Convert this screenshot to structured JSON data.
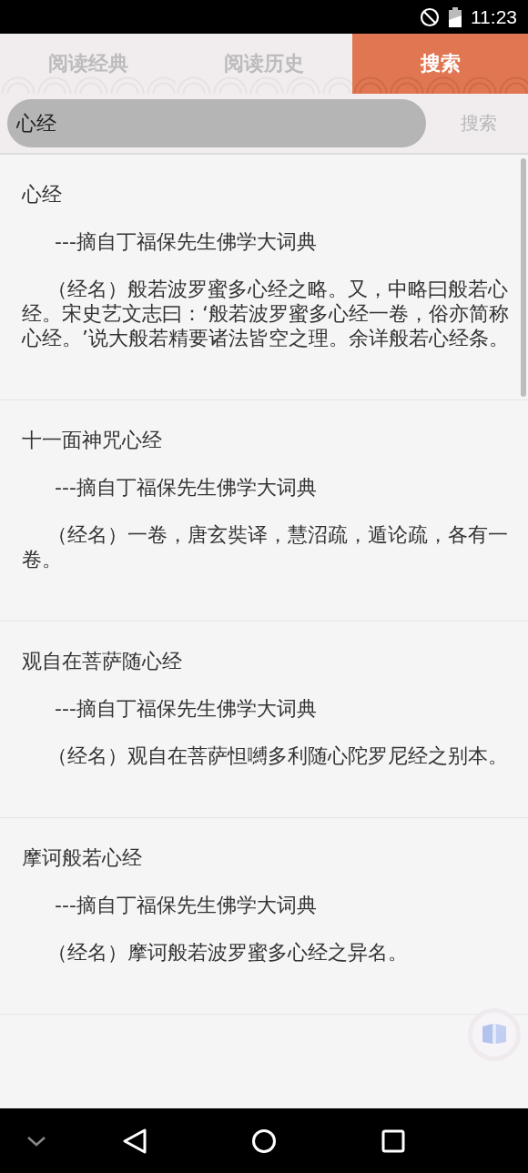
{
  "status_bar": {
    "time": "11:23"
  },
  "tabs": [
    {
      "label": "阅读经典",
      "selected": false
    },
    {
      "label": "阅读历史",
      "selected": false
    },
    {
      "label": "搜索",
      "selected": true
    }
  ],
  "search": {
    "value": "心经",
    "button": "搜索"
  },
  "results": [
    {
      "title": "心经",
      "source": "---摘自丁福保先生佛学大词典",
      "body": "（经名）般若波罗蜜多心经之略。又，中略曰般若心经。宋史艺文志曰：‘般若波罗蜜多心经一卷，俗亦简称心经。’说大般若精要诸法皆空之理。余详般若心经条。"
    },
    {
      "title": "十一面神咒心经",
      "source": "---摘自丁福保先生佛学大词典",
      "body": "（经名）一卷，唐玄奘译，慧沼疏，遁论疏，各有一卷。"
    },
    {
      "title": "观自在菩萨随心经",
      "source": "---摘自丁福保先生佛学大词典",
      "body": "（经名）观自在菩萨怛嚩多利随心陀罗尼经之别本。"
    },
    {
      "title": "摩诃般若心经",
      "source": "---摘自丁福保先生佛学大词典",
      "body": "（经名）摩诃般若波罗蜜多心经之异名。"
    }
  ]
}
